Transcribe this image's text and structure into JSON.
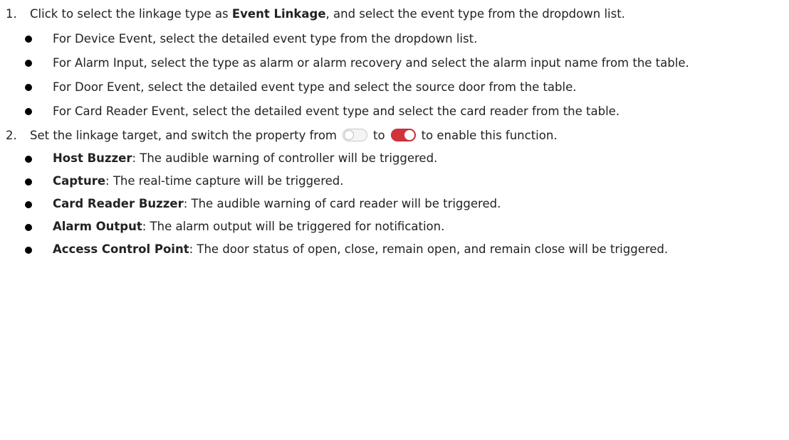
{
  "step1": {
    "number": "1.",
    "pre": "Click to select the linkage type as ",
    "bold": "Event Linkage",
    "post": ", and select the event type from the dropdown list.",
    "bullets": [
      "For Device Event, select the detailed event type from the dropdown list.",
      "For Alarm Input, select the type as alarm or alarm recovery and select the alarm input name from the table.",
      "For Door Event, select the detailed event type and select the source door from the table.",
      "For Card Reader Event, select the detailed event type and select the card reader from the table."
    ]
  },
  "step2": {
    "number": "2.",
    "pre": "Set the linkage target, and switch the property from",
    "mid": "to",
    "post": "to enable this function.",
    "toggle_off_state": "off",
    "toggle_on_state": "on",
    "toggle_on_color": "#d0343a",
    "bullets": [
      {
        "term": "Host Buzzer",
        "text": ": The audible warning of controller will be triggered."
      },
      {
        "term": "Capture",
        "text": ": The real-time capture will be triggered."
      },
      {
        "term": "Card Reader Buzzer",
        "text": ": The audible warning of card reader will be triggered."
      },
      {
        "term": "Alarm Output",
        "text": ": The alarm output will be triggered for notification."
      },
      {
        "term": "Access Control Point",
        "text": ": The door status of open, close, remain open, and remain close will be triggered."
      }
    ]
  }
}
